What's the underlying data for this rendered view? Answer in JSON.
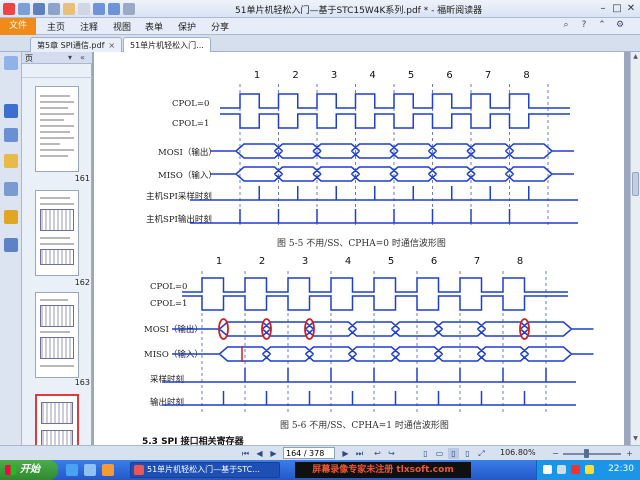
{
  "window": {
    "title": "51单片机轻松入门—基于STC15W4K系列.pdf * - 福昕阅读器",
    "controls": [
      "minimize-icon",
      "maximize-icon",
      "close-icon"
    ]
  },
  "ribbon": {
    "tabs": [
      "文件",
      "主页",
      "注释",
      "视图",
      "表单",
      "保护",
      "分享"
    ]
  },
  "doc_tabs": [
    {
      "label": "第5章 SPI通信.pdf",
      "close": "×"
    },
    {
      "label": "51单片机轻松入门...",
      "close": ""
    }
  ],
  "pages_panel": {
    "label": "页",
    "page_numbers": [
      "161",
      "162",
      "163"
    ]
  },
  "document": {
    "figure1": {
      "clock_numbers": [
        "1",
        "2",
        "3",
        "4",
        "5",
        "6",
        "7",
        "8"
      ],
      "signals": [
        "CPOL=0",
        "CPOL=1",
        "MOSI（输出）",
        "MISO（输入）",
        "主机SPI采样时刻",
        "主机SPI输出时刻"
      ],
      "caption": "图 5-5  不用/SS、CPHA=0 时通信波形图"
    },
    "figure2": {
      "clock_numbers": [
        "1",
        "2",
        "3",
        "4",
        "5",
        "6",
        "7",
        "8"
      ],
      "signals": [
        "CPOL=0",
        "CPOL=1",
        "MOSI（输出）",
        "MISO（输入）",
        "采样时刻",
        "输出时刻"
      ],
      "caption": "图 5-6  不用/SS、CPHA=1 时通信波形图"
    },
    "next_section": "5.3  SPI 接口相关寄存器"
  },
  "statusbar": {
    "page_field": "164 / 378",
    "zoom": "106.80%"
  },
  "taskbar": {
    "start_label": "开始",
    "task_label": "51单片机轻松入门—基于STC...",
    "watermark": "屏幕录像专家未注册 tlxsoft.com",
    "clock": "22:30"
  },
  "colors": {
    "signal_blue": "#1f3fd0",
    "highlight_red": "#d42020",
    "file_tab": "#f08a1a",
    "taskbar_blue": "#2457c8"
  }
}
